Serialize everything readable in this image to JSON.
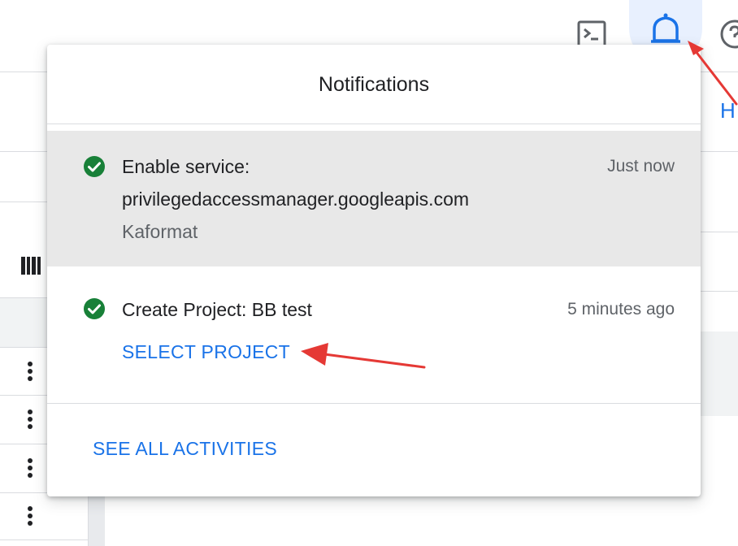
{
  "popover": {
    "title": "Notifications",
    "notifications": [
      {
        "title_line1": "Enable service:",
        "title_line2": "privilegedaccessmanager.googleapis.com",
        "project": "Kaformat",
        "time": "Just now",
        "status_icon": "check-circle-icon"
      },
      {
        "title_line1": "Create Project: BB test",
        "time": "5 minutes ago",
        "action_label": "SELECT PROJECT",
        "status_icon": "check-circle-icon"
      }
    ],
    "see_all_label": "SEE ALL ACTIVITIES"
  },
  "toolbar": {
    "icons": [
      "terminal-icon",
      "bell-icon",
      "help-icon"
    ]
  },
  "background": {
    "partial_link_text": "H"
  },
  "colors": {
    "accent": "#1a73e8",
    "success": "#188038",
    "annotation": "#e53935",
    "highlight_row": "#e8e8e8",
    "bell_highlight": "#e8f0fe"
  }
}
